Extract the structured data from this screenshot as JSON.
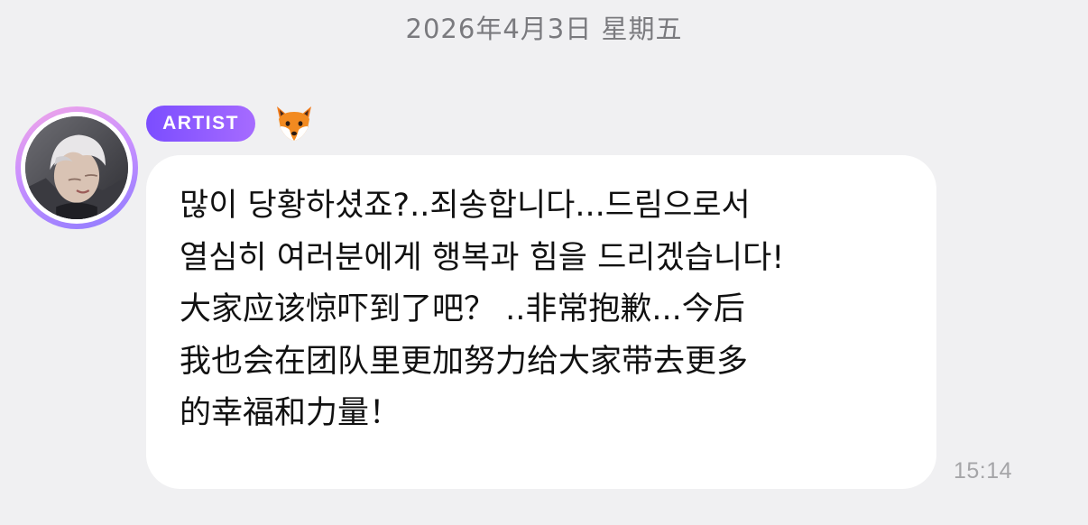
{
  "date_header": "2026年4月3日 星期五",
  "sender": {
    "badge": "ARTIST",
    "avatar_icon": "avatar-photo",
    "emoji_icon": "fox-emoji-icon"
  },
  "message": {
    "lines": [
      "많이 당황하셨죠?..죄송합니다...드림으로서",
      "열심히 여러분에게 행복과 힘을 드리겠습니다!",
      "大家应该惊吓到了吧？ ..非常抱歉...今后",
      "我也会在团队里更加努力给大家带去更多",
      "的幸福和力量！"
    ],
    "time": "15:14"
  },
  "colors": {
    "background": "#f0f0f2",
    "bubble": "#ffffff",
    "badge_start": "#7b4dff",
    "badge_end": "#a66bff",
    "ring_start": "#f2a6e6",
    "ring_end": "#8d7bff"
  }
}
